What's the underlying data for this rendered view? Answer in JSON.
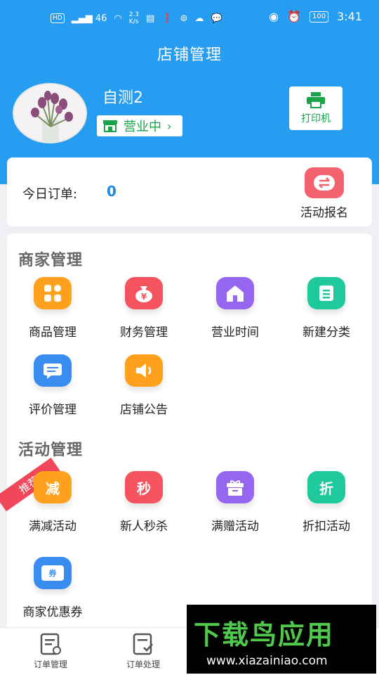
{
  "status_bar": {
    "hd": "HD",
    "signal": "46",
    "speed_top": "2.3",
    "speed_bottom": "K/s",
    "battery": "100",
    "time": "3:41"
  },
  "header": {
    "title": "店铺管理",
    "shop_name": "自测2",
    "status": "营业中",
    "status_arrow": "›",
    "printer_label": "打印机"
  },
  "orders": {
    "label": "今日订单:",
    "count": "0",
    "activity_signup": "活动报名"
  },
  "merchant_section": {
    "title": "商家管理",
    "items": [
      {
        "label": "商品管理",
        "icon": "grid-apps-icon",
        "color": "#ffa11c"
      },
      {
        "label": "财务管理",
        "icon": "money-bag-icon",
        "color": "#f5545f"
      },
      {
        "label": "营业时间",
        "icon": "house-icon",
        "color": "#9567f0"
      },
      {
        "label": "新建分类",
        "icon": "category-list-icon",
        "color": "#1ec99b"
      },
      {
        "label": "评价管理",
        "icon": "comment-icon",
        "color": "#3a8df0"
      },
      {
        "label": "店铺公告",
        "icon": "speaker-icon",
        "color": "#ffa11c"
      }
    ]
  },
  "activity_section": {
    "title": "活动管理",
    "ribbon": "推荐",
    "items": [
      {
        "label": "满减活动",
        "glyph": "减",
        "icon": "discount-reduce-icon",
        "color": "#ffa11c"
      },
      {
        "label": "新人秒杀",
        "glyph": "秒",
        "icon": "flash-sale-icon",
        "color": "#f5545f"
      },
      {
        "label": "满赠活动",
        "glyph": "",
        "icon": "gift-box-icon",
        "color": "#9567f0"
      },
      {
        "label": "折扣活动",
        "glyph": "折",
        "icon": "discount-icon",
        "color": "#1ec99b"
      },
      {
        "label": "商家优惠券",
        "glyph": "券",
        "icon": "coupon-icon",
        "color": "#3a8df0"
      }
    ]
  },
  "bottom_nav": [
    {
      "label": "订单管理",
      "icon": "order-manage-icon"
    },
    {
      "label": "订单处理",
      "icon": "order-process-icon"
    }
  ],
  "watermark": {
    "logo": "下载鸟应用",
    "url": "www.xiazainiao.com"
  }
}
